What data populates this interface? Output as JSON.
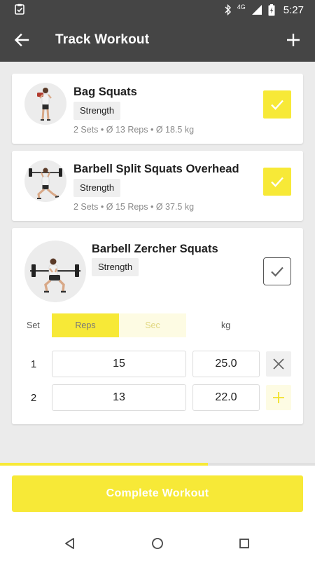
{
  "status_bar": {
    "time": "5:27",
    "network": "4G"
  },
  "app_bar": {
    "title": "Track Workout"
  },
  "exercises": [
    {
      "name": "Bag Squats",
      "category": "Strength",
      "stats": "2 Sets • Ø 13 Reps • Ø 18.5 kg",
      "completed": true
    },
    {
      "name": "Barbell Split Squats Overhead",
      "category": "Strength",
      "stats": "2 Sets • Ø 15 Reps • Ø 37.5 kg",
      "completed": true
    },
    {
      "name": "Barbell Zercher Squats",
      "category": "Strength",
      "completed": false,
      "set_table": {
        "set_label": "Set",
        "reps_label": "Reps",
        "sec_label": "Sec",
        "kg_label": "kg",
        "active_mode": "Reps",
        "rows": [
          {
            "set": "1",
            "reps": "15",
            "kg": "25.0"
          },
          {
            "set": "2",
            "reps": "13",
            "kg": "22.0"
          }
        ]
      }
    }
  ],
  "progress": {
    "fraction": 0.66
  },
  "complete_button": {
    "label": "Complete Workout"
  },
  "colors": {
    "accent": "#f7e937",
    "app_bar": "#454545",
    "background": "#ebebeb"
  },
  "icons": [
    "clipboard-check-icon",
    "bluetooth-icon",
    "signal-icon",
    "battery-icon",
    "back-arrow-icon",
    "plus-icon",
    "check-icon",
    "close-icon",
    "nav-back-icon",
    "nav-home-icon",
    "nav-recents-icon"
  ]
}
